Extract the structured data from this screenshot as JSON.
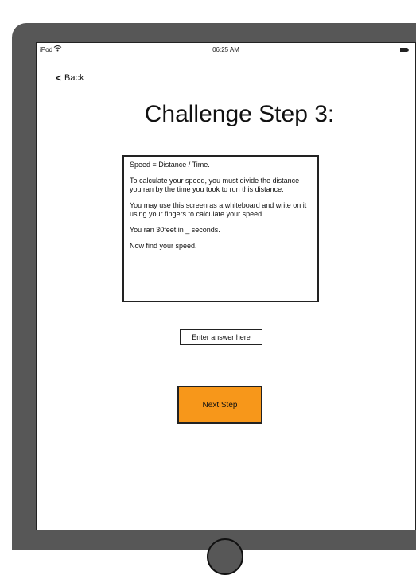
{
  "status_bar": {
    "device": "iPod",
    "wifi_icon": "wifi-icon",
    "time": "06:25 AM",
    "battery_icon": "battery-icon"
  },
  "nav": {
    "back_label": "Back",
    "back_icon": "chevron-left-icon"
  },
  "page_title": "Challenge Step 3:",
  "info": {
    "paragraphs": [
      "Speed = Distance / Time.",
      "To calculate your speed, you must divide the distance you ran by the time you took to run this distance.",
      "You may use this screen as a whiteboard and write on it using your fingers to calculate your speed.",
      "You ran 30feet in _ seconds.",
      "Now find your speed."
    ]
  },
  "answer": {
    "placeholder": "Enter answer here",
    "value": ""
  },
  "next_button": {
    "label": "Next Step",
    "color": "#f7971a"
  },
  "colors": {
    "device_frame": "#575757",
    "screen_background": "#ffffff"
  }
}
